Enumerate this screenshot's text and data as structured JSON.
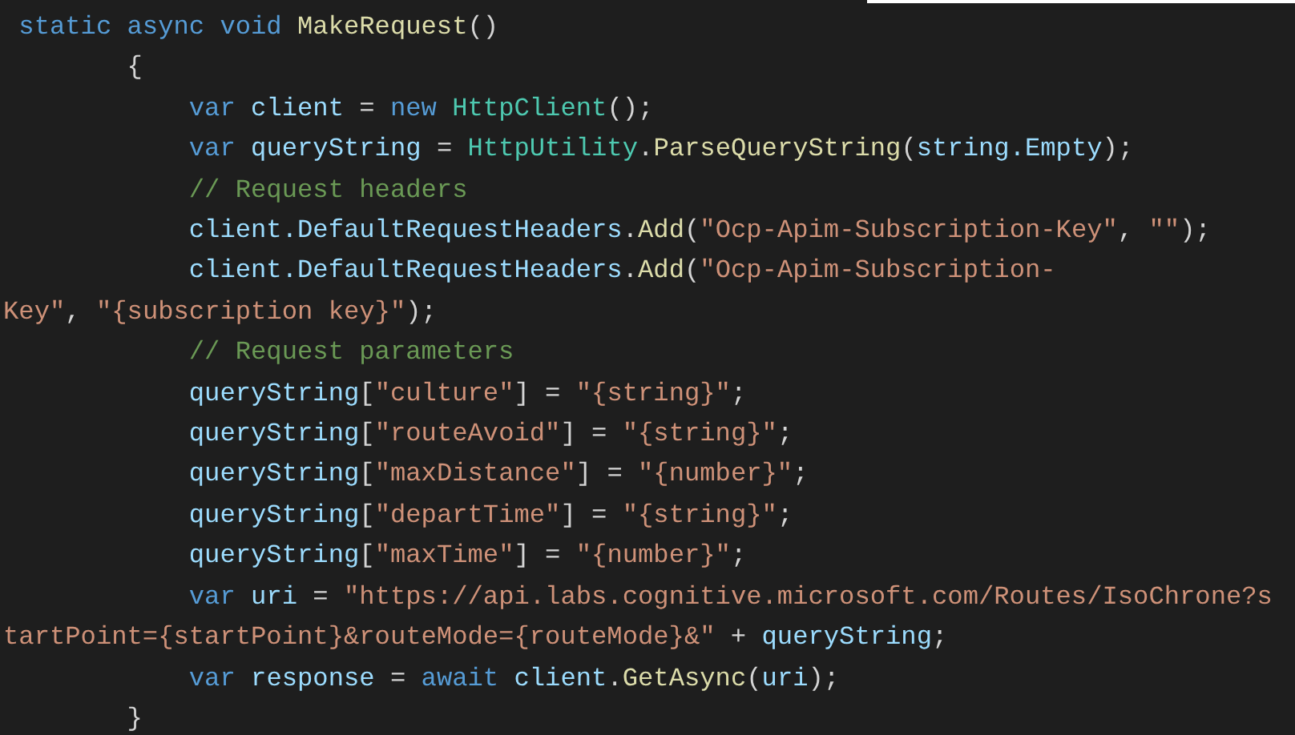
{
  "code_lines": [
    [
      {
        "kind": "keyword",
        "text": " static async void "
      },
      {
        "kind": "method",
        "text": "MakeRequest"
      },
      {
        "kind": "plain",
        "text": "()"
      }
    ],
    [
      {
        "kind": "plain",
        "text": "        {"
      }
    ],
    [
      {
        "kind": "keyword",
        "text": "            var "
      },
      {
        "kind": "variable",
        "text": "client"
      },
      {
        "kind": "plain",
        "text": " = "
      },
      {
        "kind": "keyword",
        "text": "new "
      },
      {
        "kind": "type",
        "text": "HttpClient"
      },
      {
        "kind": "plain",
        "text": "();"
      }
    ],
    [
      {
        "kind": "keyword",
        "text": "            var "
      },
      {
        "kind": "variable",
        "text": "queryString"
      },
      {
        "kind": "plain",
        "text": " = "
      },
      {
        "kind": "type",
        "text": "HttpUtility"
      },
      {
        "kind": "plain",
        "text": "."
      },
      {
        "kind": "method",
        "text": "ParseQueryString"
      },
      {
        "kind": "plain",
        "text": "("
      },
      {
        "kind": "variable",
        "text": "string.Empty"
      },
      {
        "kind": "plain",
        "text": ");"
      }
    ],
    [
      {
        "kind": "comment",
        "text": "            // Request headers"
      }
    ],
    [
      {
        "kind": "variable",
        "text": "            client.DefaultRequestHeaders"
      },
      {
        "kind": "plain",
        "text": "."
      },
      {
        "kind": "method",
        "text": "Add"
      },
      {
        "kind": "plain",
        "text": "("
      },
      {
        "kind": "string",
        "text": "\"Ocp-Apim-Subscription-Key\""
      },
      {
        "kind": "plain",
        "text": ", "
      },
      {
        "kind": "string",
        "text": "\"\""
      },
      {
        "kind": "plain",
        "text": ");"
      }
    ],
    [
      {
        "kind": "variable",
        "text": "            client.DefaultRequestHeaders"
      },
      {
        "kind": "plain",
        "text": "."
      },
      {
        "kind": "method",
        "text": "Add"
      },
      {
        "kind": "plain",
        "text": "("
      },
      {
        "kind": "string",
        "text": "\"Ocp-Apim-Subscription-"
      }
    ],
    [
      {
        "kind": "string",
        "text": "Key\""
      },
      {
        "kind": "plain",
        "text": ", "
      },
      {
        "kind": "string",
        "text": "\"{subscription key}\""
      },
      {
        "kind": "plain",
        "text": ");"
      }
    ],
    [
      {
        "kind": "comment",
        "text": "            // Request parameters"
      }
    ],
    [
      {
        "kind": "variable",
        "text": "            queryString"
      },
      {
        "kind": "plain",
        "text": "["
      },
      {
        "kind": "string",
        "text": "\"culture\""
      },
      {
        "kind": "plain",
        "text": "] = "
      },
      {
        "kind": "string",
        "text": "\"{string}\""
      },
      {
        "kind": "plain",
        "text": ";"
      }
    ],
    [
      {
        "kind": "variable",
        "text": "            queryString"
      },
      {
        "kind": "plain",
        "text": "["
      },
      {
        "kind": "string",
        "text": "\"routeAvoid\""
      },
      {
        "kind": "plain",
        "text": "] = "
      },
      {
        "kind": "string",
        "text": "\"{string}\""
      },
      {
        "kind": "plain",
        "text": ";"
      }
    ],
    [
      {
        "kind": "variable",
        "text": "            queryString"
      },
      {
        "kind": "plain",
        "text": "["
      },
      {
        "kind": "string",
        "text": "\"maxDistance\""
      },
      {
        "kind": "plain",
        "text": "] = "
      },
      {
        "kind": "string",
        "text": "\"{number}\""
      },
      {
        "kind": "plain",
        "text": ";"
      }
    ],
    [
      {
        "kind": "variable",
        "text": "            queryString"
      },
      {
        "kind": "plain",
        "text": "["
      },
      {
        "kind": "string",
        "text": "\"departTime\""
      },
      {
        "kind": "plain",
        "text": "] = "
      },
      {
        "kind": "string",
        "text": "\"{string}\""
      },
      {
        "kind": "plain",
        "text": ";"
      }
    ],
    [
      {
        "kind": "variable",
        "text": "            queryString"
      },
      {
        "kind": "plain",
        "text": "["
      },
      {
        "kind": "string",
        "text": "\"maxTime\""
      },
      {
        "kind": "plain",
        "text": "] = "
      },
      {
        "kind": "string",
        "text": "\"{number}\""
      },
      {
        "kind": "plain",
        "text": ";"
      }
    ],
    [
      {
        "kind": "keyword",
        "text": "            var "
      },
      {
        "kind": "variable",
        "text": "uri"
      },
      {
        "kind": "plain",
        "text": " = "
      },
      {
        "kind": "string",
        "text": "\"https://api.labs.cognitive.microsoft.com/Routes/IsoChrone?s"
      }
    ],
    [
      {
        "kind": "string",
        "text": "tartPoint={startPoint}&routeMode={routeMode}&\""
      },
      {
        "kind": "plain",
        "text": " + "
      },
      {
        "kind": "variable",
        "text": "queryString"
      },
      {
        "kind": "plain",
        "text": ";"
      }
    ],
    [
      {
        "kind": "keyword",
        "text": "            var "
      },
      {
        "kind": "variable",
        "text": "response"
      },
      {
        "kind": "plain",
        "text": " = "
      },
      {
        "kind": "keyword",
        "text": "await "
      },
      {
        "kind": "variable",
        "text": "client"
      },
      {
        "kind": "plain",
        "text": "."
      },
      {
        "kind": "method",
        "text": "GetAsync"
      },
      {
        "kind": "plain",
        "text": "("
      },
      {
        "kind": "variable",
        "text": "uri"
      },
      {
        "kind": "plain",
        "text": ");"
      }
    ],
    [
      {
        "kind": "plain",
        "text": "        }"
      }
    ]
  ]
}
